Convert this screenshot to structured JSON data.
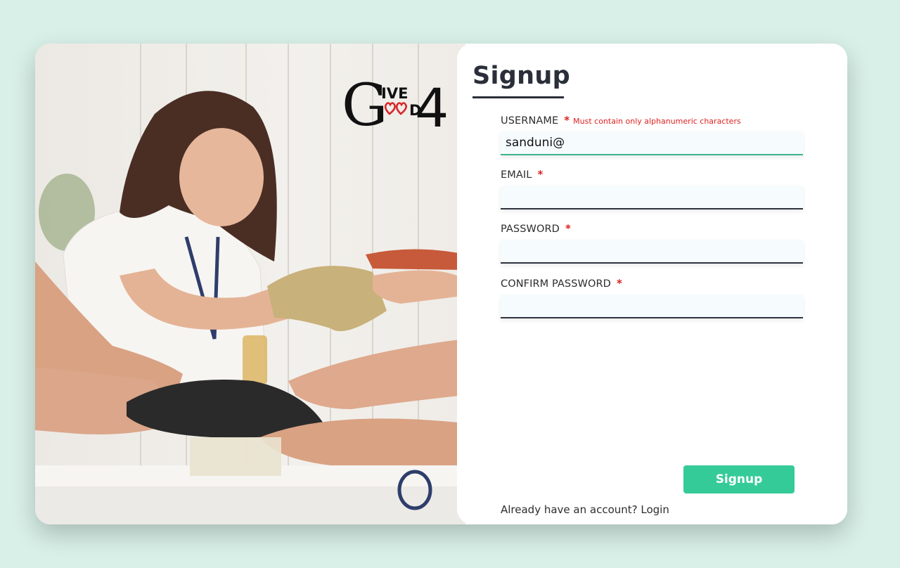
{
  "logo": {
    "text_left": "G",
    "text_top": "IVE",
    "text_bottom": "D",
    "number": "4"
  },
  "form": {
    "title": "Signup",
    "fields": [
      {
        "label": "USERNAME",
        "required": "*",
        "hint": "Must contain only alphanumeric characters",
        "value": "sanduni@"
      },
      {
        "label": "EMAIL",
        "required": "*",
        "hint": "",
        "value": ""
      },
      {
        "label": "PASSWORD",
        "required": "*",
        "hint": "",
        "value": ""
      },
      {
        "label": "CONFIRM PASSWORD",
        "required": "*",
        "hint": "",
        "value": ""
      }
    ],
    "submit_label": "Signup",
    "login_prompt": "Already have an account? Login"
  },
  "colors": {
    "accent": "#35cb98",
    "error": "#e02020",
    "background": "#d8f0e8"
  }
}
